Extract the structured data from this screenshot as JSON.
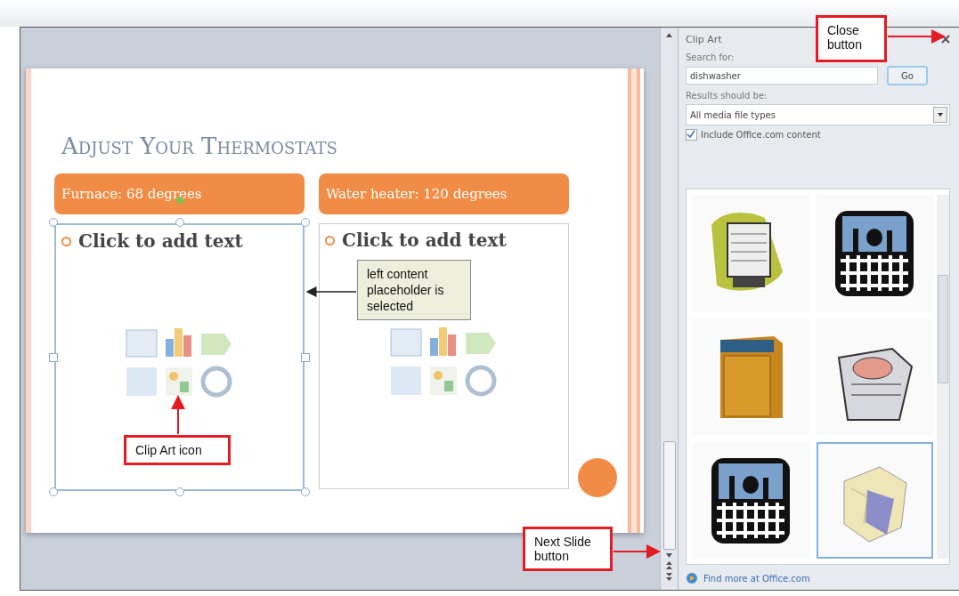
{
  "slide": {
    "title": "Adjust Your Thermostats",
    "columns": [
      {
        "heading": "Furnace: 68 degrees",
        "placeholder": "Click to add text",
        "selected": true
      },
      {
        "heading": "Water heater: 120 degrees",
        "placeholder": "Click to add text",
        "selected": false
      }
    ]
  },
  "clip_art_pane": {
    "title": "Clip Art",
    "search_label": "Search for:",
    "search_value": "dishwasher",
    "go_button": "Go",
    "results_label": "Results should be:",
    "results_value": "All media file types",
    "include_office": {
      "label": "Include Office.com content",
      "checked": true
    },
    "results": [
      {
        "kind": "open-dishwasher",
        "selected": false
      },
      {
        "kind": "place-setting",
        "selected": false
      },
      {
        "kind": "closed-dishwasher",
        "selected": false
      },
      {
        "kind": "dish-rack",
        "selected": false
      },
      {
        "kind": "place-setting",
        "selected": false
      },
      {
        "kind": "box",
        "selected": true
      }
    ],
    "find_more": "Find more at Office.com"
  },
  "callouts": [
    {
      "kind": "red",
      "text": "Close button"
    },
    {
      "kind": "note",
      "text": "left content placeholder is selected"
    },
    {
      "kind": "red",
      "text": "Clip Art icon"
    },
    {
      "kind": "red",
      "text": "Next Slide button"
    }
  ]
}
